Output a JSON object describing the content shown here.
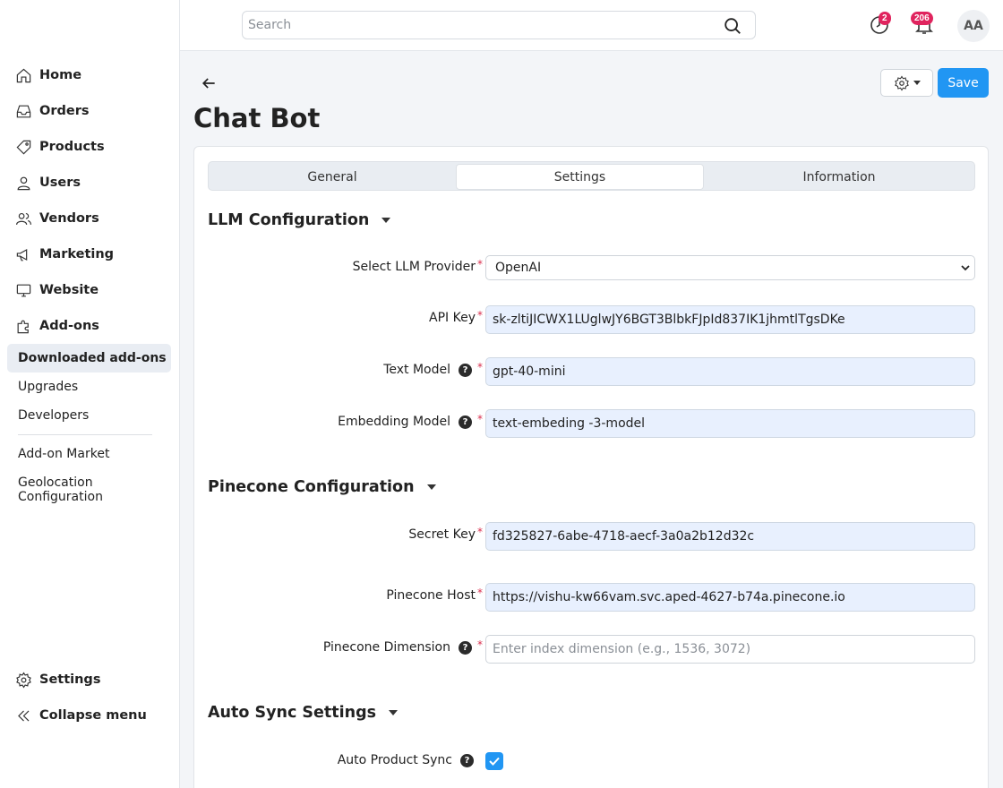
{
  "sidebar": {
    "nav": [
      {
        "label": "Home",
        "icon": "home-icon"
      },
      {
        "label": "Orders",
        "icon": "inbox-icon"
      },
      {
        "label": "Products",
        "icon": "tag-icon"
      },
      {
        "label": "Users",
        "icon": "user-icon"
      },
      {
        "label": "Vendors",
        "icon": "users-icon"
      },
      {
        "label": "Marketing",
        "icon": "megaphone-icon"
      },
      {
        "label": "Website",
        "icon": "monitor-icon"
      },
      {
        "label": "Add-ons",
        "icon": "puzzle-icon"
      }
    ],
    "sub": [
      "Downloaded add-ons",
      "Upgrades",
      "Developers",
      "Add-on Market",
      "Geolocation Configuration"
    ],
    "bottom": [
      {
        "label": "Settings",
        "icon": "gear-icon"
      },
      {
        "label": "Collapse menu",
        "icon": "double-chevron-left-icon"
      }
    ]
  },
  "topbar": {
    "search_placeholder": "Search",
    "help_badge": "2",
    "notifications_badge": "206",
    "avatar_initials": "AA"
  },
  "page": {
    "title": "Chat Bot",
    "save_label": "Save"
  },
  "tabs": [
    "General",
    "Settings",
    "Information"
  ],
  "llm": {
    "title": "LLM Configuration",
    "provider_label": "Select LLM Provider",
    "provider_value": "OpenAI",
    "api_key_label": "API Key",
    "api_key_value": "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",
    "text_model_label": "Text Model",
    "text_model_value": "gpt-40-mini",
    "embedding_label": "Embedding Model",
    "embedding_value": "text-embeding -3-model"
  },
  "pinecone": {
    "title": "Pinecone Configuration",
    "secret_label": "Secret Key",
    "secret_value": "fd325827-6abe-4718-aecf-3a0a2b12d32c",
    "host_label": "Pinecone Host",
    "host_value": "https://vishu-kw66vam.svc.aped-4627-b74a.pinecone.io",
    "dimension_label": "Pinecone Dimension",
    "dimension_placeholder": "Enter index dimension (e.g., 1536, 3072)"
  },
  "autosync": {
    "title": "Auto Sync Settings",
    "product_sync_label": "Auto Product Sync",
    "product_sync_checked": true
  },
  "colors": {
    "accent": "#2196f3",
    "badge": "#e0245e",
    "required": "#d9304f"
  }
}
